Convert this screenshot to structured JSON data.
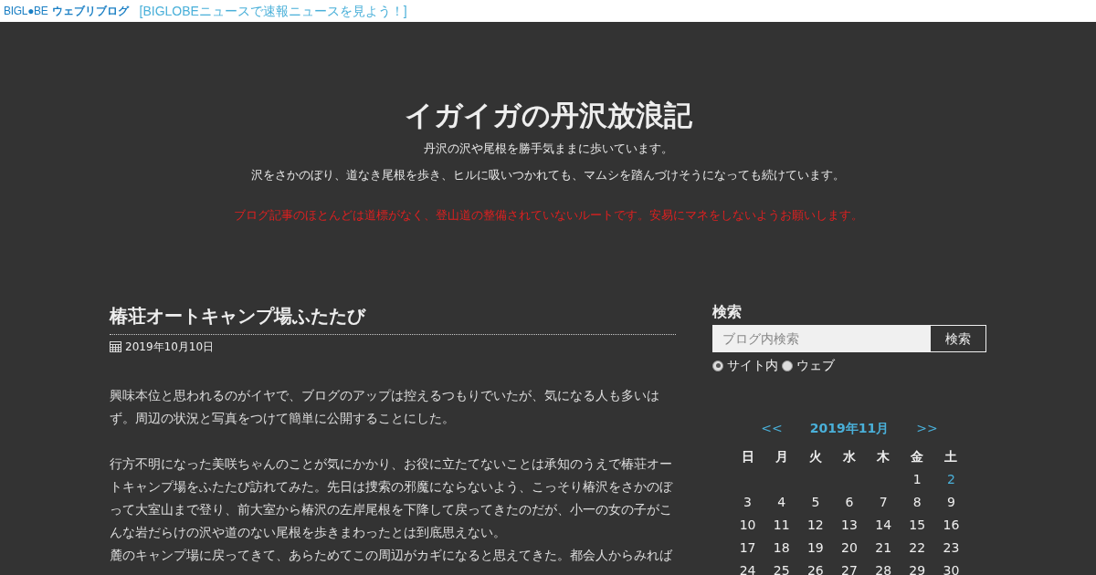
{
  "topbar": {
    "logo": "BIGL●BE",
    "logo_sub": "ウェブリブログ",
    "news_link": "[BIGLOBEニュースで速報ニュースを見よう！]"
  },
  "header": {
    "title": "イガイガの丹沢放浪記",
    "lines": [
      "丹沢の沢や尾根を勝手気ままに歩いています。",
      "沢をさかのぼり、道なき尾根を歩き、ヒルに吸いつかれても、マムシを踏んづけそうになっても続けています。"
    ],
    "warning": "ブログ記事のほとんどは道標がなく、登山道の整備されていないルートです。安易にマネをしないようお願いします。"
  },
  "post": {
    "title": "椿荘オートキャンプ場ふたたび",
    "date": "2019年10月10日",
    "blocks": [
      [
        "興味本位と思われるのがイヤで、ブログのアップは控えるつもりでいたが、気になる人も多いはず。周辺の状況と写真をつけて簡単に公開することにした。"
      ],
      [
        "行方不明になった美咲ちゃんのことが気にかかり、お役に立たてないことは承知のうえで椿荘オートキャンプ場をふたたび訪れてみた。先日は捜索の邪魔にならないよう、こっそり椿沢をさかのぼって大室山まで登り、前大室から椿沢の左岸尾根を下降して戻ってきたのだが、小一の女の子がこんな岩だらけの沢や道のない尾根を歩きまわったとは到底思えない。",
        "麓のキャンプ場に戻ってきて、あらためてこの周辺がカギになると思えてきた。都会人からみれば"
      ]
    ]
  },
  "sidebar": {
    "search": {
      "heading": "検索",
      "placeholder": "ブログ内検索",
      "button": "検索",
      "scopes": [
        {
          "label": "サイト内",
          "selected": true
        },
        {
          "label": "ウェブ",
          "selected": false
        }
      ]
    },
    "calendar": {
      "prev": "<<",
      "month": "2019年11月",
      "next": ">>",
      "weekdays": [
        "日",
        "月",
        "火",
        "水",
        "木",
        "金",
        "土"
      ],
      "weeks": [
        [
          {
            "kind": "blank"
          },
          {
            "kind": "blank"
          },
          {
            "kind": "blank"
          },
          {
            "kind": "blank"
          },
          {
            "kind": "blank"
          },
          {
            "kind": "day",
            "day": "1",
            "linked": false
          },
          {
            "kind": "day",
            "day": "2",
            "linked": true
          }
        ],
        [
          {
            "kind": "day",
            "day": "3",
            "linked": false
          },
          {
            "kind": "day",
            "day": "4",
            "linked": false
          },
          {
            "kind": "day",
            "day": "5",
            "linked": false
          },
          {
            "kind": "day",
            "day": "6",
            "linked": false
          },
          {
            "kind": "day",
            "day": "7",
            "linked": false
          },
          {
            "kind": "day",
            "day": "8",
            "linked": false
          },
          {
            "kind": "day",
            "day": "9",
            "linked": false
          }
        ],
        [
          {
            "kind": "day",
            "day": "10",
            "linked": false
          },
          {
            "kind": "day",
            "day": "11",
            "linked": false
          },
          {
            "kind": "day",
            "day": "12",
            "linked": false
          },
          {
            "kind": "day",
            "day": "13",
            "linked": false
          },
          {
            "kind": "day",
            "day": "14",
            "linked": false
          },
          {
            "kind": "day",
            "day": "15",
            "linked": false
          },
          {
            "kind": "day",
            "day": "16",
            "linked": false
          }
        ],
        [
          {
            "kind": "day",
            "day": "17",
            "linked": false
          },
          {
            "kind": "day",
            "day": "18",
            "linked": false
          },
          {
            "kind": "day",
            "day": "19",
            "linked": false
          },
          {
            "kind": "day",
            "day": "20",
            "linked": false
          },
          {
            "kind": "day",
            "day": "21",
            "linked": false
          },
          {
            "kind": "day",
            "day": "22",
            "linked": false
          },
          {
            "kind": "day",
            "day": "23",
            "linked": false
          }
        ],
        [
          {
            "kind": "day",
            "day": "24",
            "linked": false
          },
          {
            "kind": "day",
            "day": "25",
            "linked": false
          },
          {
            "kind": "day",
            "day": "26",
            "linked": false
          },
          {
            "kind": "day",
            "day": "27",
            "linked": false
          },
          {
            "kind": "day",
            "day": "28",
            "linked": false
          },
          {
            "kind": "day",
            "day": "29",
            "linked": false
          },
          {
            "kind": "day",
            "day": "30",
            "linked": false
          }
        ]
      ]
    }
  }
}
